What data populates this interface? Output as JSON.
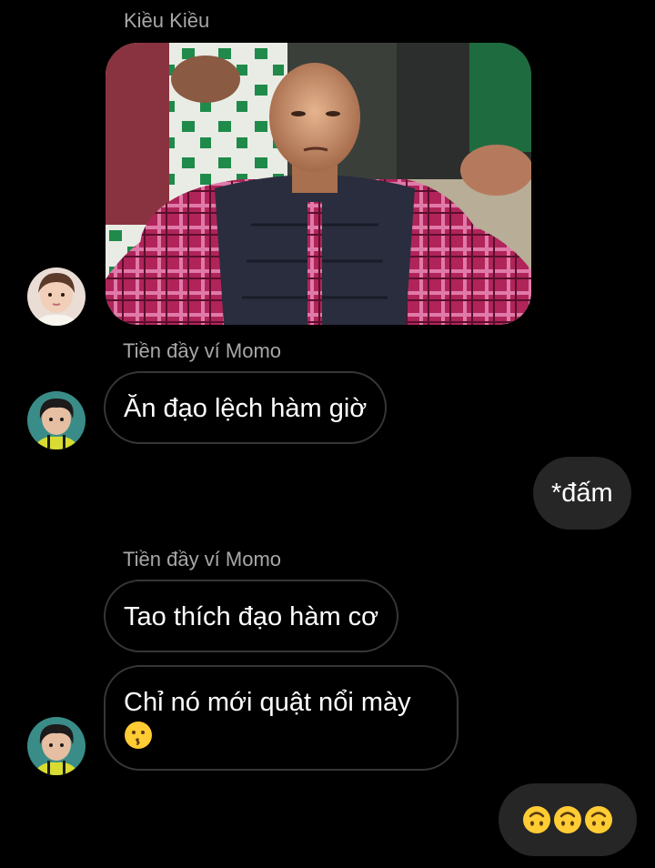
{
  "messages": {
    "m1": {
      "sender": "Kiều Kiều"
    },
    "m2": {
      "sender": "Tiền đầy ví Momo",
      "text": "Ăn đạo lệch hàm giờ"
    },
    "m3": {
      "text": "*đấm"
    },
    "m4": {
      "sender": "Tiền đầy ví Momo",
      "text": "Tao thích đạo hàm cơ"
    },
    "m5": {
      "text": "Chỉ nó mới quật nổi mày"
    },
    "m6": {
      "text": ""
    }
  },
  "emoji": {
    "kissing": "kissing-face-emoji",
    "upside_down": "upside-down-face-emoji",
    "upside_down_count": 3
  },
  "colors": {
    "background": "#000000",
    "sender_name": "#a8a8a8",
    "incoming_border": "#363636",
    "outgoing_bubble": "#262626",
    "text": "#ffffff",
    "emoji_yellow": "#ffcc33"
  }
}
